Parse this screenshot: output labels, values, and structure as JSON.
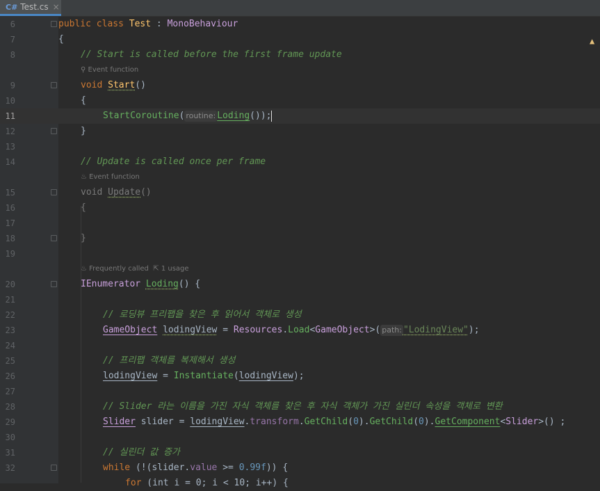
{
  "tab": {
    "lang": "C#",
    "filename": "Test.cs",
    "close": "×"
  },
  "editor": {
    "warning_icon": "warning-triangle-icon",
    "hints": {
      "event_function_1": "Event function",
      "event_function_2": "Event function",
      "frequently_called": "Frequently called",
      "usage": "1 usage"
    },
    "lines": [
      {
        "n": "6",
        "kind": "code"
      },
      {
        "n": "7",
        "kind": "code"
      },
      {
        "n": "8",
        "kind": "code"
      },
      {
        "n": "9",
        "kind": "code"
      },
      {
        "n": "10",
        "kind": "code"
      },
      {
        "n": "11",
        "kind": "code"
      },
      {
        "n": "12",
        "kind": "code"
      },
      {
        "n": "13",
        "kind": "code"
      },
      {
        "n": "14",
        "kind": "code"
      },
      {
        "n": "15",
        "kind": "code"
      },
      {
        "n": "16",
        "kind": "code"
      },
      {
        "n": "17",
        "kind": "code"
      },
      {
        "n": "18",
        "kind": "code"
      },
      {
        "n": "19",
        "kind": "code"
      },
      {
        "n": "20",
        "kind": "code"
      },
      {
        "n": "21",
        "kind": "code"
      },
      {
        "n": "22",
        "kind": "code"
      },
      {
        "n": "23",
        "kind": "code"
      },
      {
        "n": "24",
        "kind": "code"
      },
      {
        "n": "25",
        "kind": "code"
      },
      {
        "n": "26",
        "kind": "code"
      },
      {
        "n": "27",
        "kind": "code"
      },
      {
        "n": "28",
        "kind": "code"
      },
      {
        "n": "29",
        "kind": "code"
      },
      {
        "n": "30",
        "kind": "code"
      },
      {
        "n": "31",
        "kind": "code"
      },
      {
        "n": "32",
        "kind": "code"
      }
    ],
    "code": {
      "l6_public": "public",
      "l6_class": "class",
      "l6_name": "Test",
      "l6_colon": " : ",
      "l6_base": "MonoBehaviour",
      "l7": "{",
      "l8": "// Start is called before the first frame update",
      "l9_void": "void",
      "l9_name": "Start",
      "l9_paren": "()",
      "l10": "{",
      "l11_fn": "StartCoroutine",
      "l11_open": "(",
      "l11_param": "routine:",
      "l11_arg": "Loding",
      "l11_close": "());",
      "l12": "}",
      "l14": "// Update is called once per frame",
      "l15_void": "void",
      "l15_name": "Update",
      "l15_paren": "()",
      "l16": "{",
      "l18": "}",
      "l20_type": "IEnumerator",
      "l20_name": "Loding",
      "l20_rest": "() {",
      "l22": "// 로딩뷰 프리팹을 찾은 후 읽어서 객체로 생성",
      "l23_type": "GameObject",
      "l23_var": "lodingView",
      "l23_eq": " = ",
      "l23_res": "Resources",
      "l23_dot": ".",
      "l23_load": "Load",
      "l23_lt": "<",
      "l23_gt": "GameObject",
      "l23_rest1": ">(",
      "l23_param": "path:",
      "l23_str": "\"LodingView\"",
      "l23_end": ");",
      "l25": "// 프리팹 객체를 복제해서 생성",
      "l26_var": "lodingView",
      "l26_eq": " = ",
      "l26_fn": "Instantiate",
      "l26_open": "(",
      "l26_arg": "lodingView",
      "l26_end": ");",
      "l28": "// Slider 라는 이름을 가진 자식 객체를 찾은 후 자식 객체가 가진 실린더 속성을 객체로 변환",
      "l29_type": "Slider",
      "l29_var": " slider = ",
      "l29_obj": "lodingView",
      "l29_dot1": ".",
      "l29_tr": "transform",
      "l29_dot2": ".",
      "l29_gc1": "GetChild",
      "l29_p1o": "(",
      "l29_n1": "0",
      "l29_p1c": ").",
      "l29_gc2": "GetChild",
      "l29_p2o": "(",
      "l29_n2": "0",
      "l29_p2c": ").",
      "l29_gcomp": "GetComponent",
      "l29_lt": "<",
      "l29_slider": "Slider",
      "l29_end": ">() ;",
      "l31": "// 실린더 값 증가",
      "l32_while": "while",
      "l32_open": " (!(",
      "l32_obj": "slider",
      "l32_dot": ".",
      "l32_val": "value",
      "l32_op": " >= ",
      "l32_num": "0.99f",
      "l32_end": ")) {",
      "l33_for": "for",
      "l33_rest": " (int i = 0; i < 10; i++) {"
    }
  }
}
